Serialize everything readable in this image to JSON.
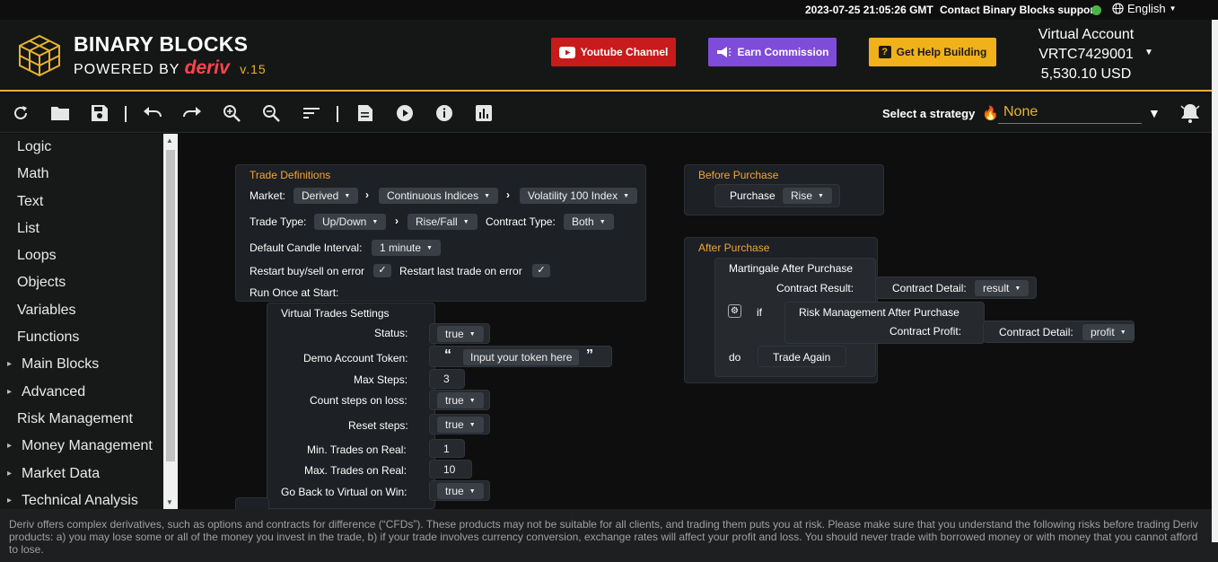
{
  "topbar": {
    "timestamp": "2023-07-25 21:05:26 GMT",
    "support": "Contact Binary Blocks support",
    "status_color": "#4bb543",
    "language": "English"
  },
  "header": {
    "brand_line1": "BINARY BLOCKS",
    "brand_line2_prefix": "POWERED BY",
    "brand_line2_deriv": "deriv",
    "version": "v.15",
    "youtube_label": "Youtube Channel",
    "earn_label": "Earn Commission",
    "help_label": "Get Help Building",
    "account_type": "Virtual Account",
    "account_id": "VRTC7429001",
    "balance": "5,530.10 USD"
  },
  "toolbar": {
    "icons": [
      "reset-icon",
      "open-folder-icon",
      "save-icon",
      "undo-icon",
      "redo-icon",
      "zoom-in-icon",
      "zoom-out-icon",
      "sort-icon",
      "notes-icon",
      "run-icon",
      "info-icon",
      "chart-icon"
    ],
    "strategy_label": "Select a strategy",
    "strategy_value": "None"
  },
  "sidebar": {
    "items": [
      {
        "label": "Logic",
        "expandable": false
      },
      {
        "label": "Math",
        "expandable": false
      },
      {
        "label": "Text",
        "expandable": false
      },
      {
        "label": "List",
        "expandable": false
      },
      {
        "label": "Loops",
        "expandable": false
      },
      {
        "label": "Objects",
        "expandable": false
      },
      {
        "label": "Variables",
        "expandable": false
      },
      {
        "label": "Functions",
        "expandable": false
      },
      {
        "label": "Main Blocks",
        "expandable": true
      },
      {
        "label": "Advanced",
        "expandable": true
      },
      {
        "label": "Risk Management",
        "expandable": false
      },
      {
        "label": "Money Management",
        "expandable": true
      },
      {
        "label": "Market Data",
        "expandable": true
      },
      {
        "label": "Technical Analysis",
        "expandable": true
      }
    ]
  },
  "trade_definitions": {
    "title": "Trade Definitions",
    "market_label": "Market:",
    "market": "Derived",
    "submarket": "Continuous Indices",
    "symbol": "Volatility 100 Index",
    "trade_type_label": "Trade Type:",
    "trade_type": "Up/Down",
    "trade_subtype": "Rise/Fall",
    "contract_type_label": "Contract Type:",
    "contract_type": "Both",
    "candle_label": "Default Candle Interval:",
    "candle_interval": "1 minute",
    "restart_buysell_label": "Restart buy/sell on error",
    "restart_last_label": "Restart last trade on error",
    "check_mark": "✓",
    "run_once_label": "Run Once at Start:"
  },
  "virtual_trades": {
    "title": "Virtual Trades Settings",
    "status_label": "Status:",
    "status": "true",
    "token_label": "Demo Account Token:",
    "token_placeholder": "Input your token here",
    "open_quote": "“",
    "close_quote": "”",
    "max_steps_label": "Max Steps:",
    "max_steps": "3",
    "count_steps_label": "Count steps on loss:",
    "count_steps": "true",
    "reset_steps_label": "Reset steps:",
    "reset_steps": "true",
    "min_trades_label": "Min. Trades on Real:",
    "min_trades": "1",
    "max_trades_label": "Max. Trades on Real:",
    "max_trades": "10",
    "go_back_label": "Go Back to Virtual on Win:",
    "go_back": "true"
  },
  "before_purchase": {
    "title": "Before Purchase",
    "purchase_label": "Purchase",
    "purchase_value": "Rise"
  },
  "after_purchase": {
    "title": "After Purchase",
    "martingale_label": "Martingale After Purchase",
    "contract_result_label": "Contract Result:",
    "contract_detail_label": "Contract Detail:",
    "contract_detail_value": "result",
    "if_label": "if",
    "risk_label": "Risk Management After Purchase",
    "contract_profit_label": "Contract Profit:",
    "contract_detail2_label": "Contract Detail:",
    "contract_detail2_value": "profit",
    "do_label": "do",
    "trade_again_label": "Trade Again"
  },
  "footer": {
    "disclaimer": "Deriv offers complex derivatives, such as options and contracts for difference (“CFDs”). These products may not be suitable for all clients, and trading them puts you at risk. Please make sure that you understand the following risks before trading Deriv products: a) you may lose some or all of the money you invest in the trade, b) if your trade involves currency conversion, exchange rates will affect your profit and loss. You should never trade with borrowed money or with money that you cannot afford to lose."
  },
  "colors": {
    "accent": "#e8b22f",
    "block_title": "#f2a536",
    "youtube": "#c81b1b",
    "earn": "#7f4bd9",
    "help": "#f0b11a"
  }
}
